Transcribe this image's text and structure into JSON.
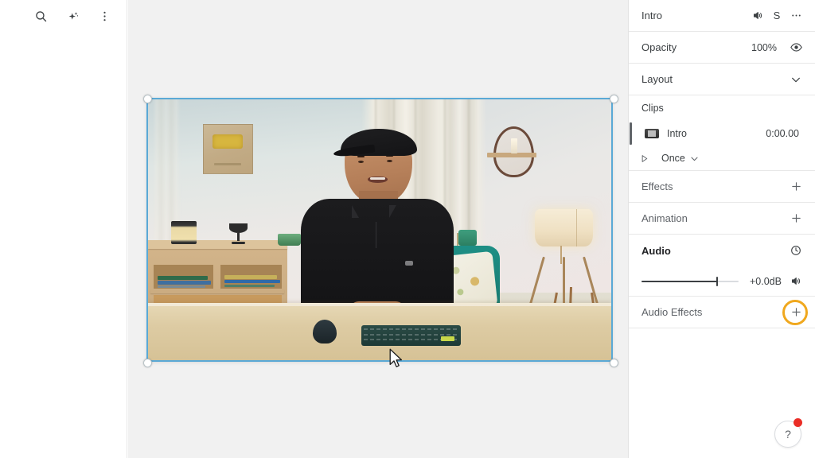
{
  "toolbar": {
    "search_icon": "search-icon",
    "magic_icon": "sparkle-icon",
    "more_icon": "more-vertical-icon"
  },
  "canvas": {
    "selection_color": "#5aa9d6",
    "background": "#f1f1f1",
    "cursor": "arrow-pointer"
  },
  "panel": {
    "clip": {
      "title": "Intro",
      "mute_icon": "speaker-icon",
      "solo_label": "S",
      "more_icon": "more-horizontal-icon"
    },
    "opacity": {
      "label": "Opacity",
      "value": "100%",
      "visibility_icon": "eye-icon"
    },
    "layout": {
      "label": "Layout",
      "chevron_icon": "chevron-down-icon"
    },
    "clips": {
      "header": "Clips",
      "items": [
        {
          "name": "Intro",
          "time": "0:00.00",
          "thumb_icon": "video-thumbnail-icon"
        }
      ],
      "loop": {
        "play_icon": "play-triangle-icon",
        "mode": "Once",
        "chevron_icon": "chevron-down-icon"
      }
    },
    "effects": {
      "label": "Effects",
      "add_icon": "plus-icon"
    },
    "animation": {
      "label": "Animation",
      "add_icon": "plus-icon"
    },
    "audio": {
      "label": "Audio",
      "clock_icon": "clock-icon",
      "gain": "+0.0dB",
      "slider_percent": 77,
      "volume_icon": "speaker-icon"
    },
    "audio_effects": {
      "label": "Audio Effects",
      "add_icon": "plus-icon",
      "highlight_color": "#f0a81e"
    }
  },
  "help": {
    "label": "?",
    "badge_color": "#ea2d26"
  }
}
